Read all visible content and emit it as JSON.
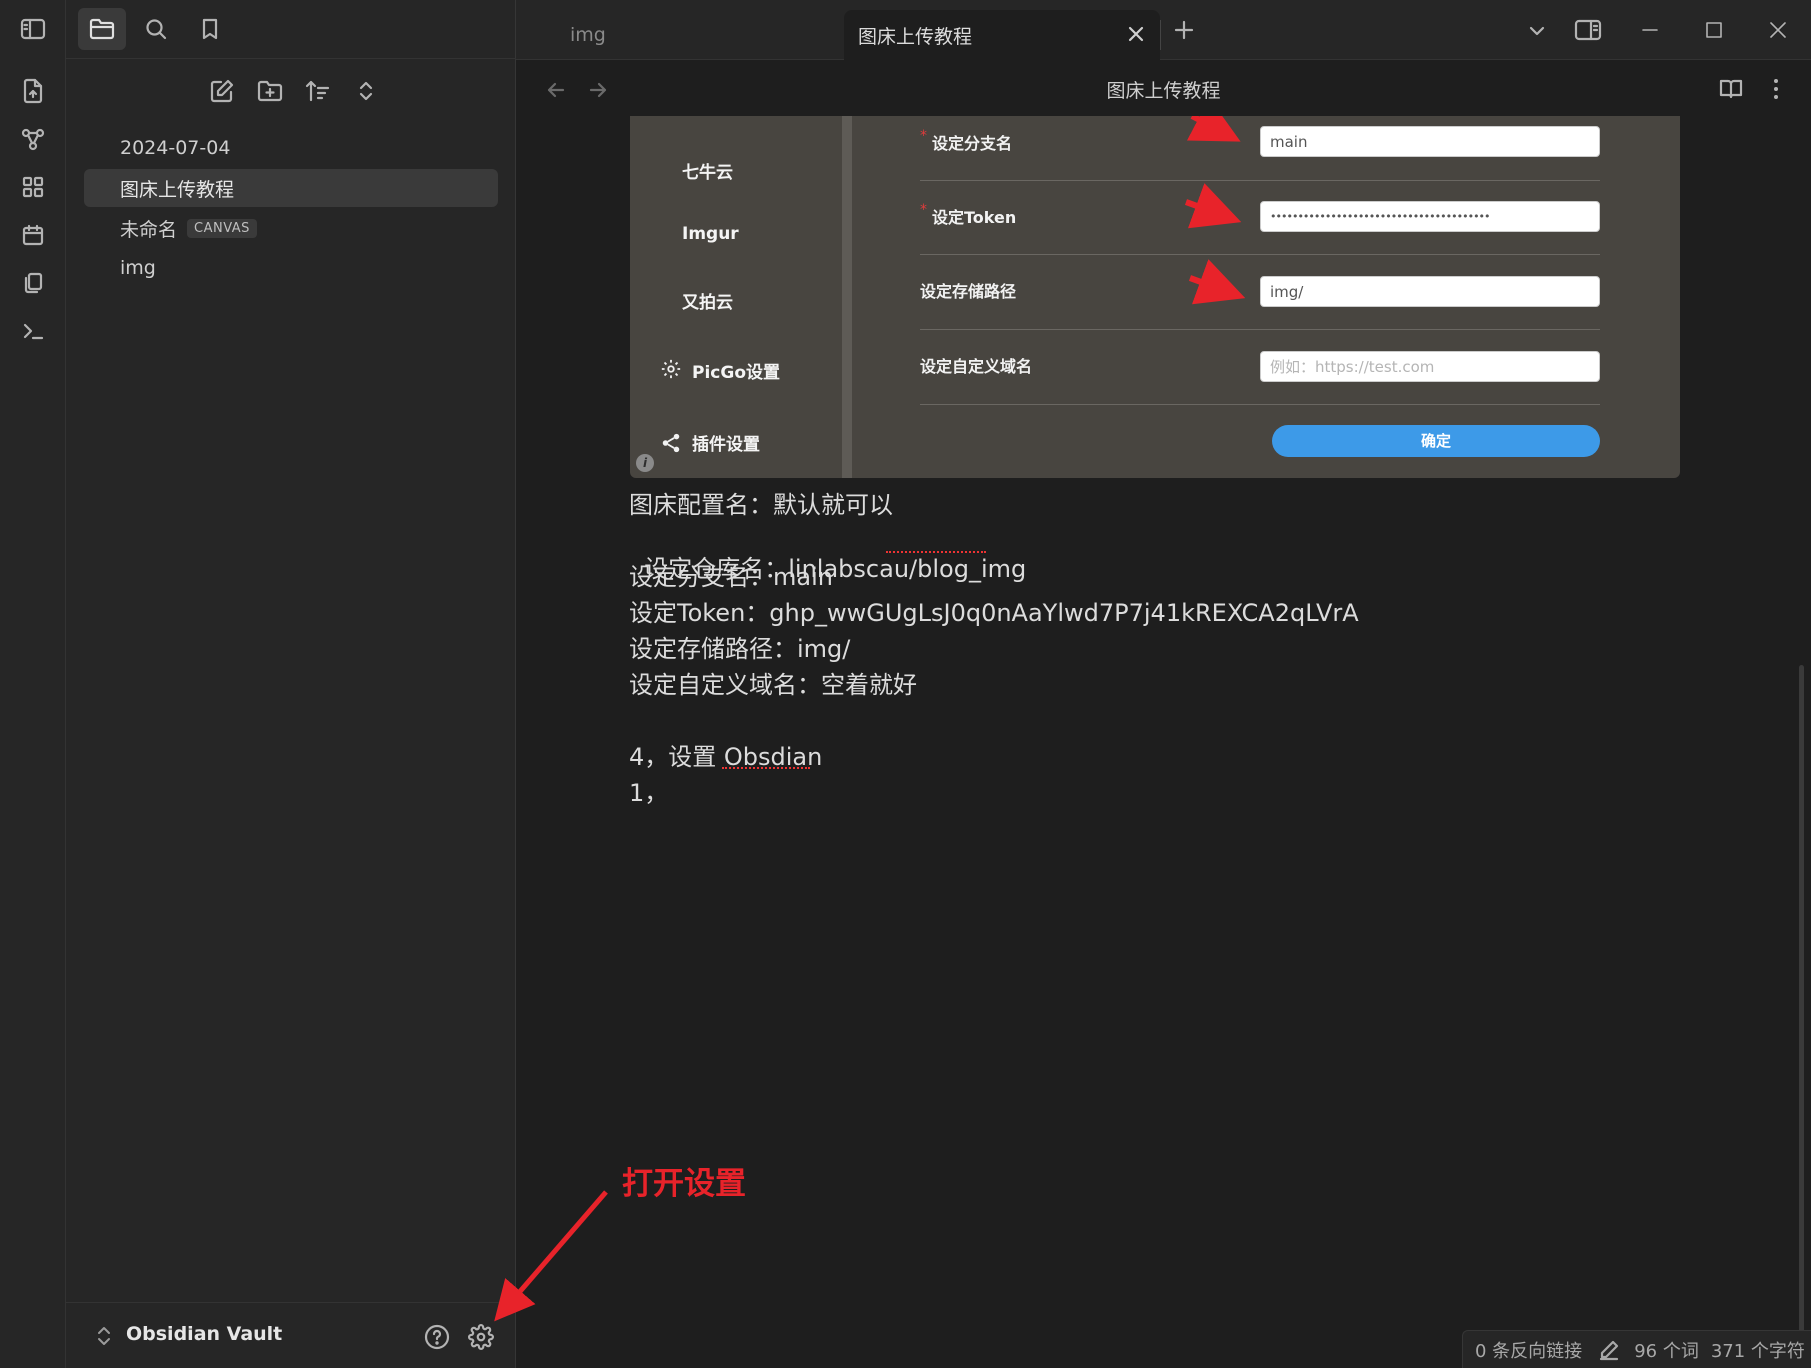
{
  "tabs": [
    {
      "label": "img",
      "active": false
    },
    {
      "label": "图床上传教程",
      "active": true
    }
  ],
  "view_header": {
    "title": "图床上传教程"
  },
  "sidebar": {
    "files": [
      {
        "name": "2024-07-04",
        "active": false
      },
      {
        "name": "图床上传教程",
        "active": true
      },
      {
        "name": "未命名",
        "badge": "CANVAS",
        "active": false
      },
      {
        "name": "img",
        "active": false
      }
    ],
    "vault_name": "Obsidian Vault"
  },
  "embed": {
    "nav_items": [
      "七牛云",
      "Imgur",
      "又拍云",
      "PicGo设置",
      "插件设置"
    ],
    "fields": [
      {
        "label": "设定分支名",
        "required": true,
        "value": "main",
        "placeholder": ""
      },
      {
        "label": "设定Token",
        "required": true,
        "value": "••••••••••••••••••••••••••••••••••••••••",
        "placeholder": ""
      },
      {
        "label": "设定存储路径",
        "required": false,
        "value": "img/",
        "placeholder": ""
      },
      {
        "label": "设定自定义域名",
        "required": false,
        "value": "",
        "placeholder": "例如：https://test.com"
      }
    ],
    "confirm_label": "确定",
    "required_mark": "*",
    "info_mark": "i"
  },
  "document": {
    "lines": [
      "图床配置名：默认就可以",
      "设定仓库名：linlabscau/blog_img",
      "设定分支名：main",
      "设定Token：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",
      "设定存储路径：img/",
      "设定自定义域名：空着就好",
      "",
      "4，设置 Obsdian",
      "1，"
    ]
  },
  "annotation": {
    "text": "打开设置",
    "color": "#e8232a"
  },
  "status_bar": {
    "backlinks": "0 条反向链接",
    "words": "96 个词",
    "chars": "371 个字符"
  },
  "colors": {
    "accent_blue": "#3d9ae8",
    "arrow_red": "#e8232a"
  }
}
